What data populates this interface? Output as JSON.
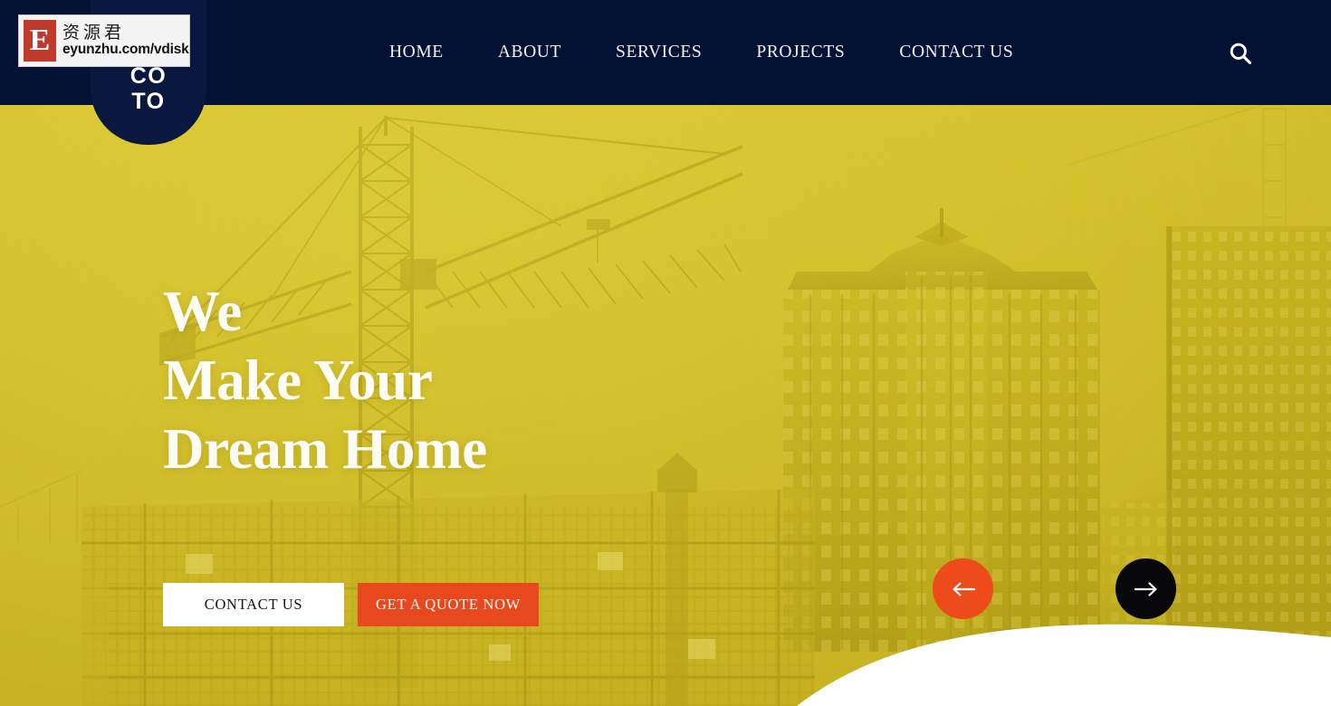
{
  "site": {
    "logo": {
      "line1": "CO",
      "line2": "TO",
      "name": "coto-logo"
    }
  },
  "header": {
    "background_color": "#031234",
    "nav_items": [
      {
        "label": "HOME"
      },
      {
        "label": "ABOUT"
      },
      {
        "label": "SERVICES"
      },
      {
        "label": "PROJECTS"
      },
      {
        "label": "CONTACT US"
      }
    ],
    "search": {
      "icon": "search-icon",
      "label": "Search"
    }
  },
  "hero": {
    "background_color": "#d3c02c",
    "title_line1": "We",
    "title_line2": "Make Your",
    "title_line3": "Dream Home",
    "buttons": {
      "secondary_label": "CONTACT US",
      "primary_label": "GET A QUOTE NOW",
      "primary_color": "#e8481e",
      "secondary_color": "#ffffff"
    },
    "carousel": {
      "prev_icon": "arrow-left-icon",
      "next_icon": "arrow-right-icon",
      "prev_color": "#ed4b1c",
      "next_color": "#08080b"
    }
  },
  "watermark": {
    "badge_letter": "E",
    "chinese_text": "资源君",
    "url_text": "eyunzhu.com/vdisk",
    "badge_color": "#c0392b"
  }
}
